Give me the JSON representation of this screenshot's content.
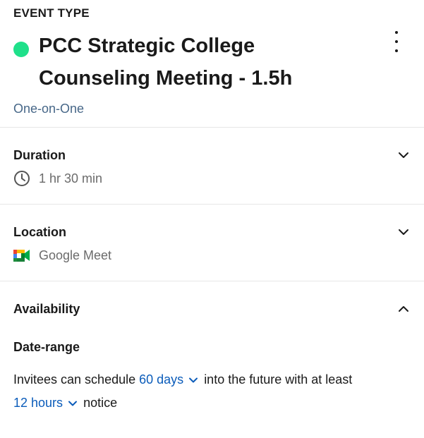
{
  "event": {
    "eyebrow": "EVENT TYPE",
    "status_color": "#1fe08a",
    "title_line1": "PCC Strategic College",
    "title_line2": "Counseling Meeting - 1.5h",
    "type": "One-on-One",
    "menu_icon": "kebab-menu-icon"
  },
  "duration": {
    "label": "Duration",
    "value": "1 hr 30 min",
    "icon": "clock-icon",
    "expanded": false
  },
  "location": {
    "label": "Location",
    "value": "Google Meet",
    "icon": "google-meet-icon",
    "expanded": false
  },
  "availability": {
    "label": "Availability",
    "expanded": true,
    "date_range": {
      "label": "Date-range",
      "text_before": "Invitees can schedule",
      "days_value": "60 days",
      "text_middle": "into the future with at least",
      "notice_value": "12 hours",
      "text_after": "notice"
    }
  },
  "colors": {
    "accent_link": "#0b5cba",
    "subtitle": "#476788",
    "muted": "#6b6b6b"
  }
}
